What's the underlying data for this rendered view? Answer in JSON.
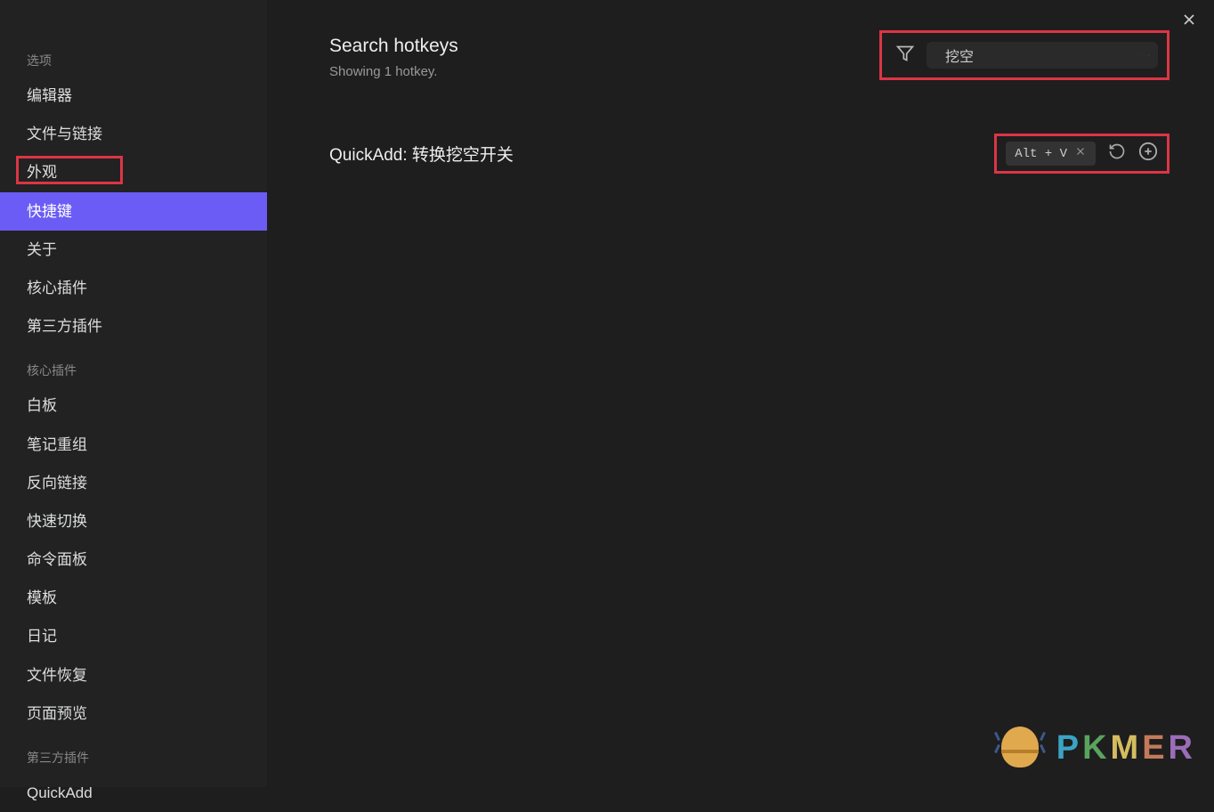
{
  "sidebar": {
    "sections": [
      {
        "header": "选项",
        "items": [
          "编辑器",
          "文件与链接",
          "外观",
          "快捷键",
          "关于",
          "核心插件",
          "第三方插件"
        ],
        "activeIndex": 3
      },
      {
        "header": "核心插件",
        "items": [
          "白板",
          "笔记重组",
          "反向链接",
          "快速切换",
          "命令面板",
          "模板",
          "日记",
          "文件恢复",
          "页面预览"
        ],
        "activeIndex": -1
      },
      {
        "header": "第三方插件",
        "items": [
          "QuickAdd"
        ],
        "activeIndex": -1
      }
    ]
  },
  "main": {
    "title": "Search hotkeys",
    "subtitle": "Showing 1 hotkey.",
    "search_value": "挖空",
    "hotkey_label": "QuickAdd: 转换挖空开关",
    "hotkey_binding": "Alt + V"
  },
  "watermark": {
    "text": "PKMER"
  }
}
